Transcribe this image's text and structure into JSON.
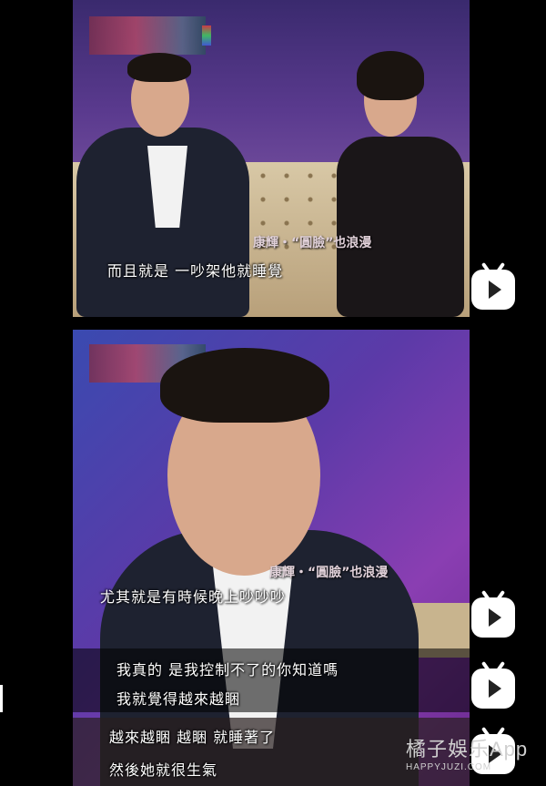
{
  "panel1": {
    "subtitle": "而且就是 一吵架他就睡覺",
    "caption": "康輝・“圓臉”也浪漫"
  },
  "panel2": {
    "subtitle_main": "尤其就是有時候晚上吵吵吵",
    "caption": "康輝・“圓臉”也浪漫",
    "subtitles_extra": [
      "我真的 是我控制不了的你知道嗎",
      "我就覺得越來越睏",
      "越來越睏 越睏 就睡著了",
      "然後她就很生氣"
    ]
  },
  "watermark": {
    "title": "橘子娛乐App",
    "url": "HAPPYJUZI.COM"
  },
  "icons": [
    "play-icon",
    "play-icon",
    "play-icon",
    "play-icon"
  ],
  "colors": {
    "background": "#000000",
    "subtitle": "#ffffff",
    "play_button": "#ffffff"
  }
}
